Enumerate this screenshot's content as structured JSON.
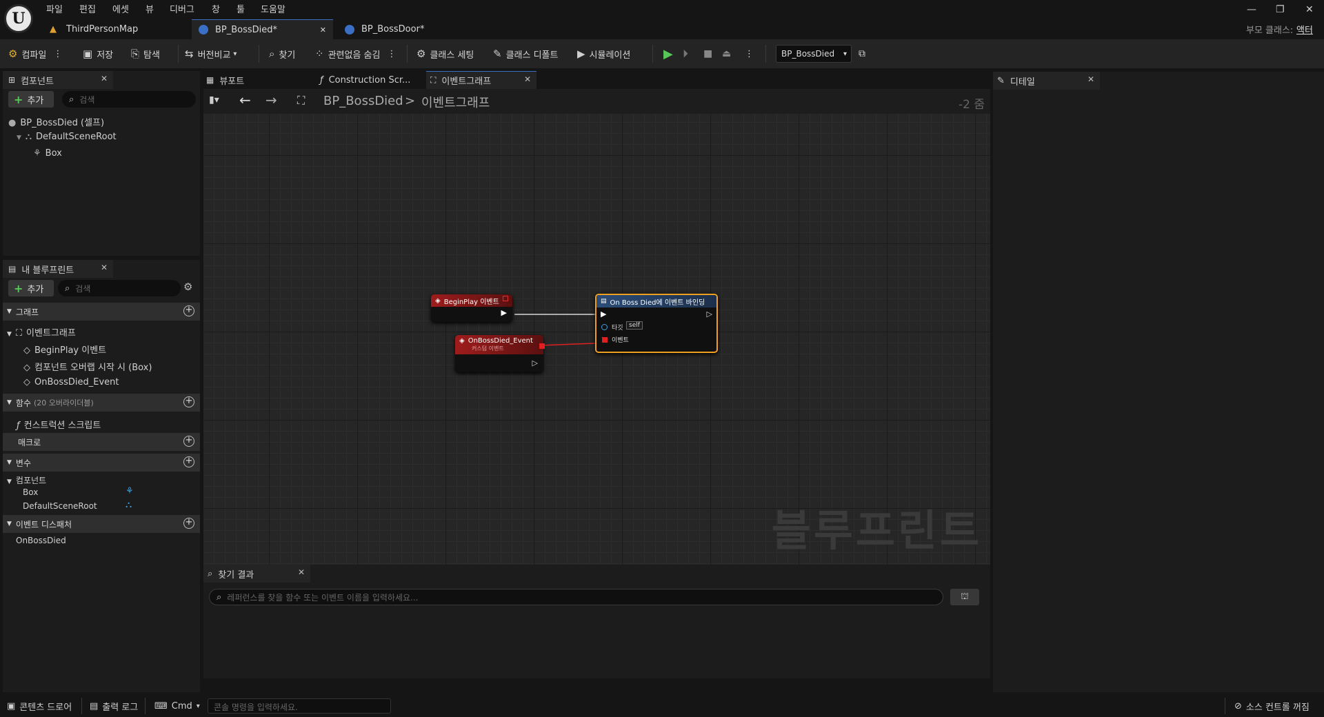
{
  "menu": [
    "파일",
    "편집",
    "에셋",
    "뷰",
    "디버그",
    "창",
    "툴",
    "도움말"
  ],
  "doc_tabs": [
    {
      "label": "ThirdPersonMap"
    },
    {
      "label": "BP_BossDied*"
    },
    {
      "label": "BP_BossDoor*"
    }
  ],
  "parent_class": {
    "label": "부모 클래스:",
    "value": "액터"
  },
  "window": {
    "minimize": "—",
    "restore": "❐",
    "close": "✕"
  },
  "toolbar": {
    "compile": "컴파일",
    "save": "저장",
    "browse": "탐색",
    "diff": "버전비교",
    "find": "찾기",
    "hide_unrelated": "관련없음 숨김",
    "class_settings": "클래스 세팅",
    "class_defaults": "클래스 디폴트",
    "simulation": "시뮬레이션",
    "debug_object": "BP_BossDied"
  },
  "components_panel": {
    "title": "컴포넌트",
    "add": "추가",
    "search_placeholder": "검색",
    "tree": [
      {
        "label": "BP_BossDied (셀프)"
      },
      {
        "label": "DefaultSceneRoot"
      },
      {
        "label": "Box"
      }
    ]
  },
  "my_blueprint": {
    "title": "내 블루프린트",
    "add": "추가",
    "search_placeholder": "검색",
    "graphs_label": "그래프",
    "event_graph": "이벤트그래프",
    "events": [
      "BeginPlay 이벤트",
      "컴포넌트 오버랩 시작 시 (Box)",
      "OnBossDied_Event"
    ],
    "functions_label": "함수",
    "functions_count": "(20 오버라이더블)",
    "construction_script": "컨스트럭션 스크립트",
    "macros_label": "매크로",
    "variables_label": "변수",
    "components_label": "컴포넌트",
    "variables": [
      "Box",
      "DefaultSceneRoot"
    ],
    "dispatchers_label": "이벤트 디스패처",
    "dispatchers": [
      "OnBossDied"
    ]
  },
  "graph_tabs": [
    {
      "label": "뷰포트"
    },
    {
      "label": "Construction Scr..."
    },
    {
      "label": "이벤트그래프"
    }
  ],
  "graph": {
    "breadcrumb_root": "BP_BossDied",
    "breadcrumb_sep": ">",
    "breadcrumb_current": "이벤트그래프",
    "zoom": "-2 줌",
    "watermark": "블루프린트",
    "nodes": {
      "beginplay": {
        "title": "BeginPlay 이벤트"
      },
      "custom_event": {
        "title": "OnBossDied_Event",
        "subtitle": "커스텀 이벤트"
      },
      "bind": {
        "title": "On Boss Died에 이벤트 바인딩",
        "target_label": "타깃",
        "target_value": "self",
        "event_label": "이벤트"
      }
    }
  },
  "find_results": {
    "title": "찾기 결과",
    "placeholder": "레퍼런스를 찾을 함수 또는 이벤트 이름을 입력하세요..."
  },
  "details": {
    "title": "디테일"
  },
  "statusbar": {
    "content_drawer": "콘텐츠 드로어",
    "output_log": "출력 로그",
    "cmd": "Cmd",
    "cmd_placeholder": "콘솔 명령을 입력하세요.",
    "source_control": "소스 컨트롤 꺼짐"
  },
  "colors": {
    "accent_blue": "#3a6fc4",
    "event_red": "#8e1b1b",
    "bind_blue": "#2c4d78",
    "selected_orange": "#f0a020",
    "exec_green": "#58c658"
  }
}
